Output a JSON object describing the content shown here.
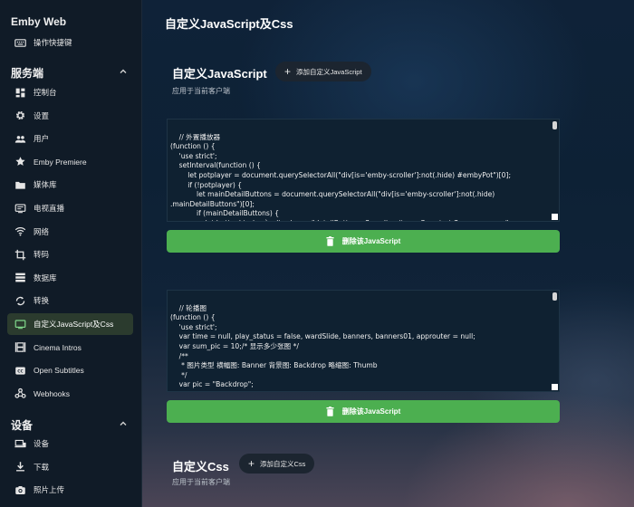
{
  "sidebar": {
    "app_title": "Emby Web",
    "shortcut_label": "操作快捷键",
    "server_section": "服务端",
    "server_items": [
      {
        "label": "控制台",
        "icon": "dashboard-icon"
      },
      {
        "label": "设置",
        "icon": "gear-icon"
      },
      {
        "label": "用户",
        "icon": "users-icon"
      },
      {
        "label": "Emby Premiere",
        "icon": "star-icon"
      },
      {
        "label": "媒体库",
        "icon": "folder-icon"
      },
      {
        "label": "电视直播",
        "icon": "tv-icon"
      },
      {
        "label": "网络",
        "icon": "wifi-icon"
      },
      {
        "label": "转码",
        "icon": "crop-icon"
      },
      {
        "label": "数据库",
        "icon": "database-icon"
      },
      {
        "label": "转换",
        "icon": "sync-icon"
      },
      {
        "label": "自定义JavaScript及Css",
        "icon": "monitor-icon",
        "active": true
      },
      {
        "label": "Cinema Intros",
        "icon": "film-icon"
      },
      {
        "label": "Open Subtitles",
        "icon": "subtitles-icon"
      },
      {
        "label": "Webhooks",
        "icon": "webhook-icon"
      }
    ],
    "devices_section": "设备",
    "device_items": [
      {
        "label": "设备",
        "icon": "devices-icon"
      },
      {
        "label": "下载",
        "icon": "download-icon"
      },
      {
        "label": "照片上传",
        "icon": "camera-icon"
      }
    ]
  },
  "main": {
    "page_title": "自定义JavaScript及Css",
    "js_section": {
      "title": "自定义JavaScript",
      "add_label": "添加自定义JavaScript",
      "description": "应用于当前客户端"
    },
    "scripts": [
      {
        "code": "// 外置播放器\n(function () {\n    'use strict';\n    setInterval(function () {\n        let potplayer = document.querySelectorAll(\"div[is='emby-scroller']:not(.hide) #embyPot\")[0];\n        if (!potplayer) {\n            let mainDetailButtons = document.querySelectorAll(\"div[is='emby-scroller']:not(.hide)\n.mainDetailButtons\")[0];\n            if (mainDetailButtons) {\n                let buttonhtml = `<div class =\"detailButtons  flex align-items-flex-start flex-wrap-wrap\">",
        "delete_label": "删除该JavaScript"
      },
      {
        "code": "// 轮播图\n(function () {\n    'use strict';\n    var time = null, play_status = false, wardSlide, banners, banners01, approuter = null;\n    var sum_pic = 10;/* 显示多少张图 */\n    /**\n     * 图片类型 横幅图: Banner 背景图: Backdrop 略缩图: Thumb\n     */\n    var pic = \"Backdrop\";\n    /**",
        "delete_label": "删除该JavaScript"
      }
    ],
    "css_section": {
      "title": "自定义Css",
      "add_label": "添加自定义Css",
      "description": "应用于当前客户端"
    }
  },
  "colors": {
    "accent_green": "#4caf50",
    "active_nav": "#2b3b2e"
  }
}
